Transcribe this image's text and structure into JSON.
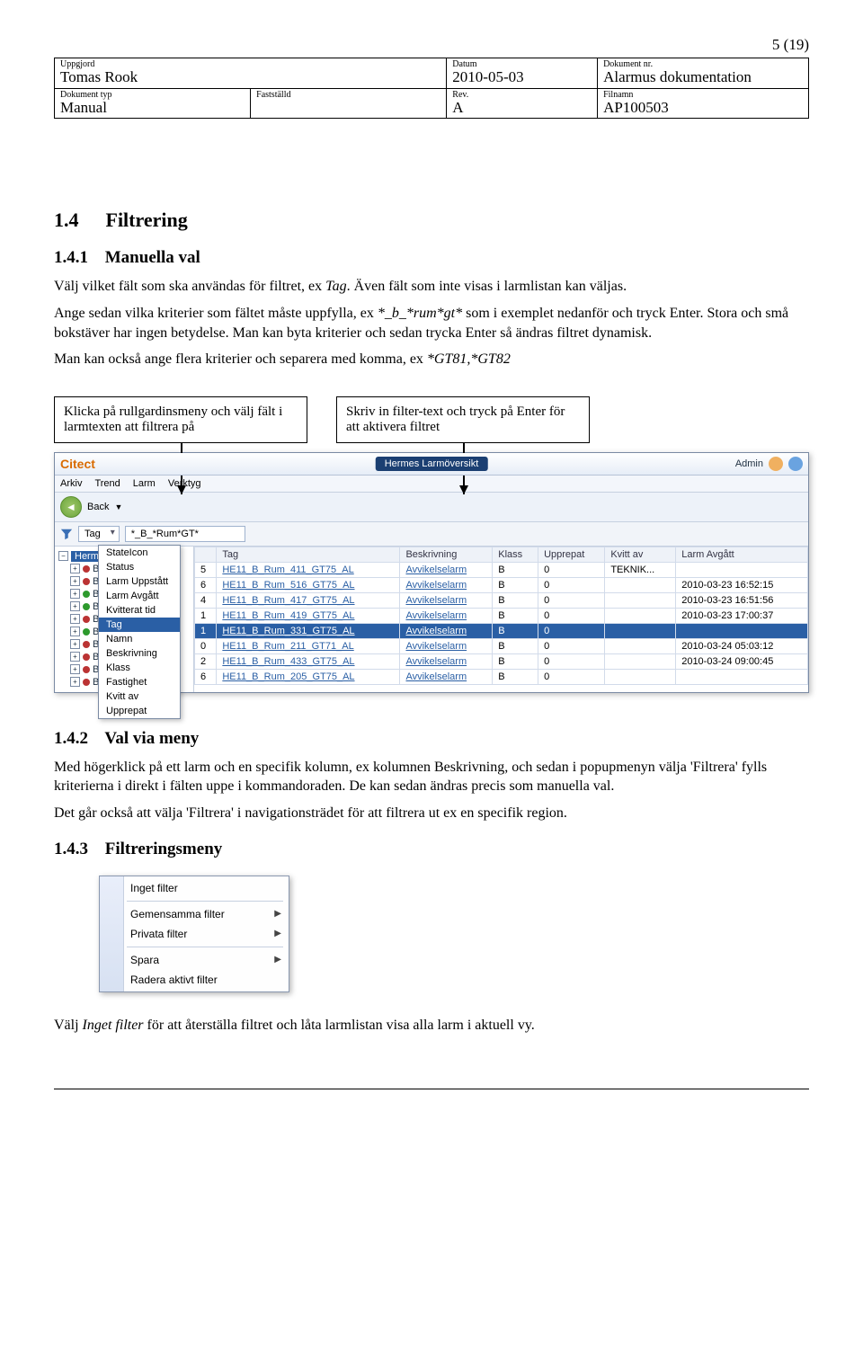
{
  "page_number": "5  (19)",
  "header": {
    "r1c1_label": "Uppgjord",
    "r1c1_value": "Tomas Rook",
    "r1c2_label": "Datum",
    "r1c2_value": "2010-05-03",
    "r1c3_label": "Dokument nr.",
    "r1c3_value": "Alarmus dokumentation",
    "r2c1_label": "Dokument typ",
    "r2c1_value": "Manual",
    "r2c2_label": "Fastställd",
    "r2c2_value": "",
    "r2c3_label": "Rev.",
    "r2c3_value": "A",
    "r2c4_label": "Filnamn",
    "r2c4_value": "AP100503"
  },
  "section_1_4_num": "1.4",
  "section_1_4_title": "Filtrering",
  "section_1_4_1_num": "1.4.1",
  "section_1_4_1_title": "Manuella val",
  "p1_a": "Välj vilket fält som ska användas för filtret, ex ",
  "p1_em": "Tag",
  "p1_b": ". Även fält som inte visas i larmlistan kan väljas.",
  "p2_a": "Ange sedan vilka kriterier som fältet måste uppfylla, ex ",
  "p2_em": "*_b_*rum*gt*",
  "p2_b": " som i exemplet nedanför och tryck Enter. Stora och små bokstäver har ingen betydelse. Man kan byta kriterier och sedan trycka Enter så ändras filtret dynamisk.",
  "p3_a": "Man kan också ange flera kriterier och separera med komma, ex ",
  "p3_em": "*GT81,*GT82",
  "callout_left": "Klicka på rullgardinsmeny och välj fält i larmtexten att filtrera på",
  "callout_right": "Skriv in filter-text och tryck på Enter för att aktivera filtret",
  "ui": {
    "app_name": "Citect",
    "window_title": "Hermes Larmöversikt",
    "user_label": "Admin",
    "menus": [
      "Arkiv",
      "Trend",
      "Larm",
      "Verktyg"
    ],
    "back_label": "Back",
    "filter_field": "Tag",
    "filter_value": "*_B_*Rum*GT*",
    "tree_root": "Hermes",
    "tree_items": [
      "Block",
      "Block",
      "Block",
      "Block",
      "Block",
      "Block",
      "Block",
      "Block",
      "Block",
      "Block"
    ],
    "popup_items": [
      "StateIcon",
      "Status",
      "Larm Uppstått",
      "Larm Avgått",
      "Kvitterat tid",
      "Tag",
      "Namn",
      "Beskrivning",
      "Klass",
      "Fastighet",
      "Kvitt av",
      "Upprepat"
    ],
    "popup_selected_index": 5,
    "table_headers": [
      "",
      "Tag",
      "Beskrivning",
      "Klass",
      "Upprepat",
      "Kvitt av",
      "Larm Avgått"
    ],
    "rows": [
      {
        "n": "5",
        "tag": "HE11_B_Rum_411_GT75_AL",
        "be": "Avvikelselarm",
        "k": "B",
        "up": "0",
        "kv": "TEKNIK...",
        "la": ""
      },
      {
        "n": "6",
        "tag": "HE11_B_Rum_516_GT75_AL",
        "be": "Avvikelselarm",
        "k": "B",
        "up": "0",
        "kv": "",
        "la": "2010-03-23 16:52:15"
      },
      {
        "n": "4",
        "tag": "HE11_B_Rum_417_GT75_AL",
        "be": "Avvikelselarm",
        "k": "B",
        "up": "0",
        "kv": "",
        "la": "2010-03-23 16:51:56"
      },
      {
        "n": "1",
        "tag": "HE11_B_Rum_419_GT75_AL",
        "be": "Avvikelselarm",
        "k": "B",
        "up": "0",
        "kv": "",
        "la": "2010-03-23 17:00:37"
      },
      {
        "n": "1",
        "tag": "HE11_B_Rum_331_GT75_AL",
        "be": "Avvikelselarm",
        "k": "B",
        "up": "0",
        "kv": "",
        "la": "",
        "sel": true
      },
      {
        "n": "0",
        "tag": "HE11_B_Rum_211_GT71_AL",
        "be": "Avvikelselarm",
        "k": "B",
        "up": "0",
        "kv": "",
        "la": "2010-03-24 05:03:12"
      },
      {
        "n": "2",
        "tag": "HE11_B_Rum_433_GT75_AL",
        "be": "Avvikelselarm",
        "k": "B",
        "up": "0",
        "kv": "",
        "la": "2010-03-24 09:00:45"
      },
      {
        "n": "6",
        "tag": "HE11_B_Rum_205_GT75_AL",
        "be": "Avvikelselarm",
        "k": "B",
        "up": "0",
        "kv": "",
        "la": ""
      }
    ]
  },
  "section_1_4_2_num": "1.4.2",
  "section_1_4_2_title": "Val via meny",
  "p4": "Med högerklick på ett larm och en specifik kolumn, ex kolumnen Beskrivning, och sedan i popupmenyn välja 'Filtrera' fylls kriterierna i direkt i fälten uppe i kommandoraden. De kan sedan ändras precis som manuella val.",
  "p5": "Det går också att välja 'Filtrera' i navigationsträdet för att filtrera ut ex en specifik region.",
  "section_1_4_3_num": "1.4.3",
  "section_1_4_3_title": "Filtreringsmeny",
  "ctx": {
    "items": [
      {
        "label": "Inget filter",
        "arrow": false,
        "sep_after": true
      },
      {
        "label": "Gemensamma filter",
        "arrow": true
      },
      {
        "label": "Privata filter",
        "arrow": true,
        "sep_after": true
      },
      {
        "label": "Spara",
        "arrow": true
      },
      {
        "label": "Radera aktivt filter",
        "arrow": false
      }
    ]
  },
  "p6_a": "Välj ",
  "p6_em": "Inget filter",
  "p6_b": " för att återställa filtret och låta larmlistan visa alla larm i aktuell vy."
}
